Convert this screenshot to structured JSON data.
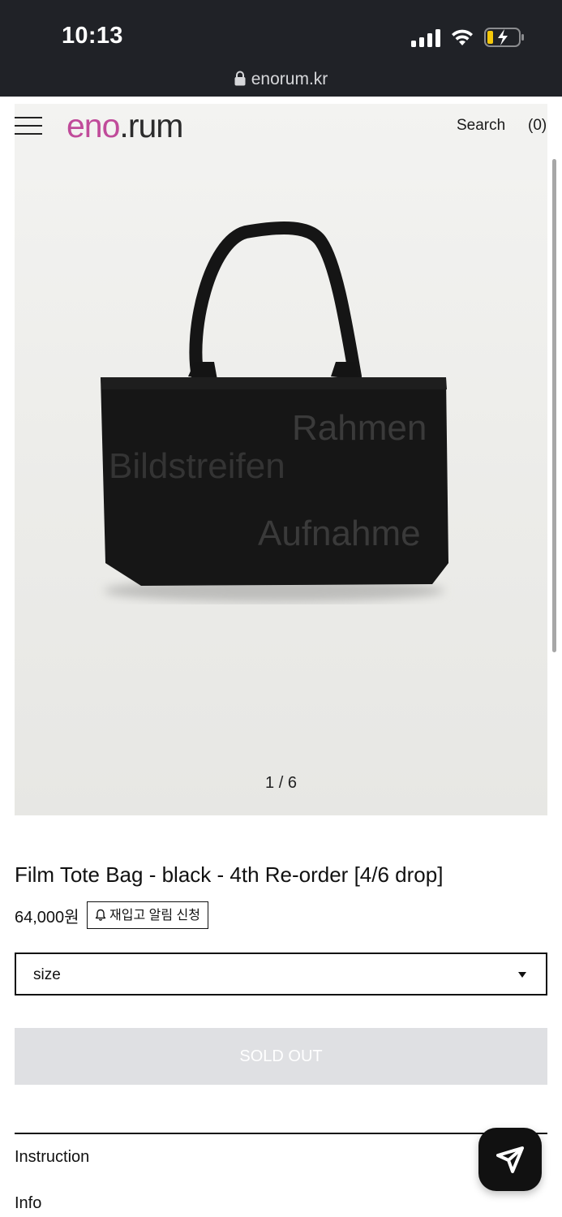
{
  "status_bar": {
    "time": "10:13"
  },
  "browser": {
    "url": "enorum.kr"
  },
  "header": {
    "logo": {
      "part1": "eno",
      "dot": ".",
      "part2": "rum"
    },
    "search_label": "Search",
    "cart_label": "(0)"
  },
  "product": {
    "image_counter": "1 / 6",
    "bag_print": [
      "Rahmen",
      "Bildstreifen",
      "Aufnahme"
    ],
    "title": "Film Tote Bag - black - 4th Re-order [4/6 drop]",
    "price": "64,000원",
    "restock_button": "재입고 알림 신청",
    "size_select": {
      "selected": "size"
    },
    "sold_out_label": "SOLD OUT"
  },
  "accordion": [
    {
      "label": "Instruction"
    },
    {
      "label": "Info"
    }
  ],
  "colors": {
    "brand_pink": "#c04b9a",
    "status_bar_bg": "#202227",
    "sold_out_bg": "#dfe0e3"
  }
}
